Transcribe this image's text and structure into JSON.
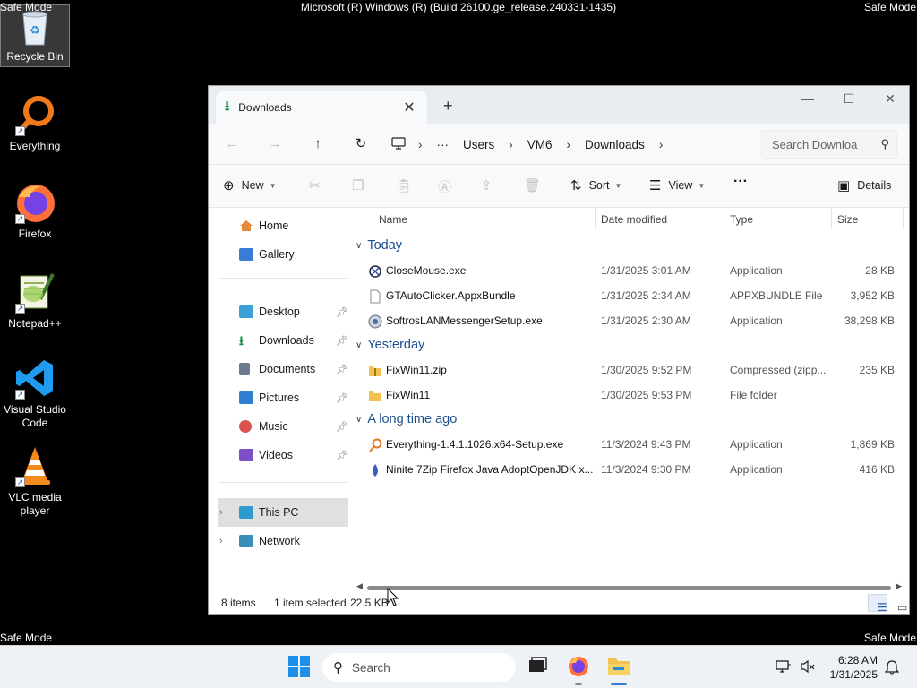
{
  "overlay": {
    "safe_mode": "Safe Mode",
    "build": "Microsoft (R) Windows (R) (Build 26100.ge_release.240331-1435)"
  },
  "desktop": {
    "icons": [
      {
        "label": "Recycle Bin",
        "icon": "recycle-bin-icon"
      },
      {
        "label": "Everything",
        "icon": "everything-icon"
      },
      {
        "label": "Firefox",
        "icon": "firefox-icon"
      },
      {
        "label": "Notepad++",
        "icon": "notepadpp-icon"
      },
      {
        "label": "Visual Studio Code",
        "icon": "vscode-icon"
      },
      {
        "label": "VLC media player",
        "icon": "vlc-icon"
      }
    ]
  },
  "window": {
    "tab_title": "Downloads",
    "breadcrumb": [
      "Users",
      "VM6",
      "Downloads"
    ],
    "search_placeholder": "Search Downloa",
    "toolbar": {
      "new_label": "New",
      "sort_label": "Sort",
      "view_label": "View",
      "details_label": "Details"
    },
    "nav": {
      "home": "Home",
      "gallery": "Gallery",
      "desktop": "Desktop",
      "downloads": "Downloads",
      "documents": "Documents",
      "pictures": "Pictures",
      "music": "Music",
      "videos": "Videos",
      "this_pc": "This PC",
      "network": "Network"
    },
    "columns": {
      "name": "Name",
      "date": "Date modified",
      "type": "Type",
      "size": "Size"
    },
    "groups": [
      {
        "label": "Today",
        "files": [
          {
            "name": "CloseMouse.exe",
            "date": "1/31/2025 3:01 AM",
            "type": "Application",
            "size": "28 KB",
            "icon": "exe-icon"
          },
          {
            "name": "GTAutoClicker.AppxBundle",
            "date": "1/31/2025 2:34 AM",
            "type": "APPXBUNDLE File",
            "size": "3,952 KB",
            "icon": "file-icon"
          },
          {
            "name": "SoftrosLANMessengerSetup.exe",
            "date": "1/31/2025 2:30 AM",
            "type": "Application",
            "size": "38,298 KB",
            "icon": "setup-icon"
          }
        ]
      },
      {
        "label": "Yesterday",
        "files": [
          {
            "name": "FixWin11.zip",
            "date": "1/30/2025 9:52 PM",
            "type": "Compressed (zipp...",
            "size": "235 KB",
            "icon": "zip-icon"
          },
          {
            "name": "FixWin11",
            "date": "1/30/2025 9:53 PM",
            "type": "File folder",
            "size": "",
            "icon": "folder-icon"
          }
        ]
      },
      {
        "label": "A long time ago",
        "files": [
          {
            "name": "Everything-1.4.1.1026.x64-Setup.exe",
            "date": "11/3/2024 9:43 PM",
            "type": "Application",
            "size": "1,869 KB",
            "icon": "everything-icon"
          },
          {
            "name": "Ninite 7Zip Firefox Java AdoptOpenJDK x...",
            "date": "11/3/2024 9:30 PM",
            "type": "Application",
            "size": "416 KB",
            "icon": "ninite-icon"
          }
        ]
      }
    ],
    "status": {
      "items": "8 items",
      "selected": "1 item selected",
      "size": "22.5 KB"
    }
  },
  "taskbar": {
    "search_placeholder": "Search",
    "time": "6:28 AM",
    "date": "1/31/2025"
  }
}
